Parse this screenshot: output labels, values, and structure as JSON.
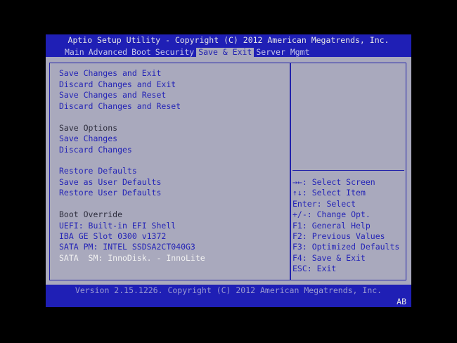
{
  "header": {
    "title": "Aptio Setup Utility - Copyright (C) 2012 American Megatrends, Inc.",
    "tabs": [
      "Main",
      "Advanced",
      "Boot",
      "Security",
      "Save & Exit",
      "Server Mgmt"
    ],
    "active_tab": "Save & Exit"
  },
  "menu": {
    "save_changes_exit": "Save Changes and Exit",
    "discard_changes_exit": "Discard Changes and Exit",
    "save_changes_reset": "Save Changes and Reset",
    "discard_changes_reset": "Discard Changes and Reset",
    "save_options_heading": "Save Options",
    "save_changes": "Save Changes",
    "discard_changes": "Discard Changes",
    "restore_defaults": "Restore Defaults",
    "save_user_defaults": "Save as User Defaults",
    "restore_user_defaults": "Restore User Defaults",
    "boot_override_heading": "Boot Override",
    "boot_options": [
      "UEFI: Built-in EFI Shell",
      "IBA GE Slot 0300 v1372",
      "SATA  PM: INTEL SSDSA2CT040G3",
      "SATA  SM: InnoDisk. - InnoLite"
    ]
  },
  "help": [
    {
      "key": "→←",
      "text": ": Select Screen"
    },
    {
      "key": "↑↓",
      "text": ": Select Item"
    },
    {
      "key": "",
      "text": "Enter: Select"
    },
    {
      "key": "",
      "text": "+/-: Change Opt."
    },
    {
      "key": "",
      "text": "F1: General Help"
    },
    {
      "key": "",
      "text": "F2: Previous Values"
    },
    {
      "key": "",
      "text": "F3: Optimized Defaults"
    },
    {
      "key": "",
      "text": "F4: Save & Exit"
    },
    {
      "key": "",
      "text": "ESC: Exit"
    }
  ],
  "footer": {
    "version": "Version 2.15.1226. Copyright (C) 2012 American Megatrends, Inc.",
    "corner": "AB"
  },
  "colors": {
    "header_bg": "#1f1fb5",
    "body_bg": "#a9a9bd",
    "action_text": "#2424b6"
  }
}
